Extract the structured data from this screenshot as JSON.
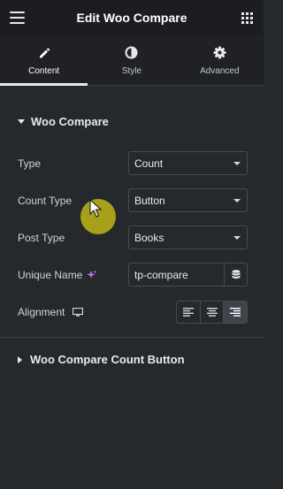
{
  "header": {
    "title": "Edit Woo Compare"
  },
  "tabs": [
    {
      "label": "Content",
      "icon": "pencil-icon",
      "active": true
    },
    {
      "label": "Style",
      "icon": "contrast-icon",
      "active": false
    },
    {
      "label": "Advanced",
      "icon": "gear-icon",
      "active": false
    }
  ],
  "section": {
    "title": "Woo Compare",
    "expanded": true
  },
  "fields": {
    "type": {
      "label": "Type",
      "value": "Count"
    },
    "count_type": {
      "label": "Count Type",
      "value": "Button"
    },
    "post_type": {
      "label": "Post Type",
      "value": "Books"
    },
    "unique_name": {
      "label": "Unique Name",
      "value": "tp-compare"
    },
    "alignment": {
      "label": "Alignment",
      "options": [
        "left",
        "center",
        "right"
      ],
      "selected": "right"
    }
  },
  "collapsed_section": {
    "title": "Woo Compare Count Button",
    "expanded": false
  },
  "colors": {
    "accent_ai": "#c36cf0",
    "cursor": "#dace14"
  }
}
